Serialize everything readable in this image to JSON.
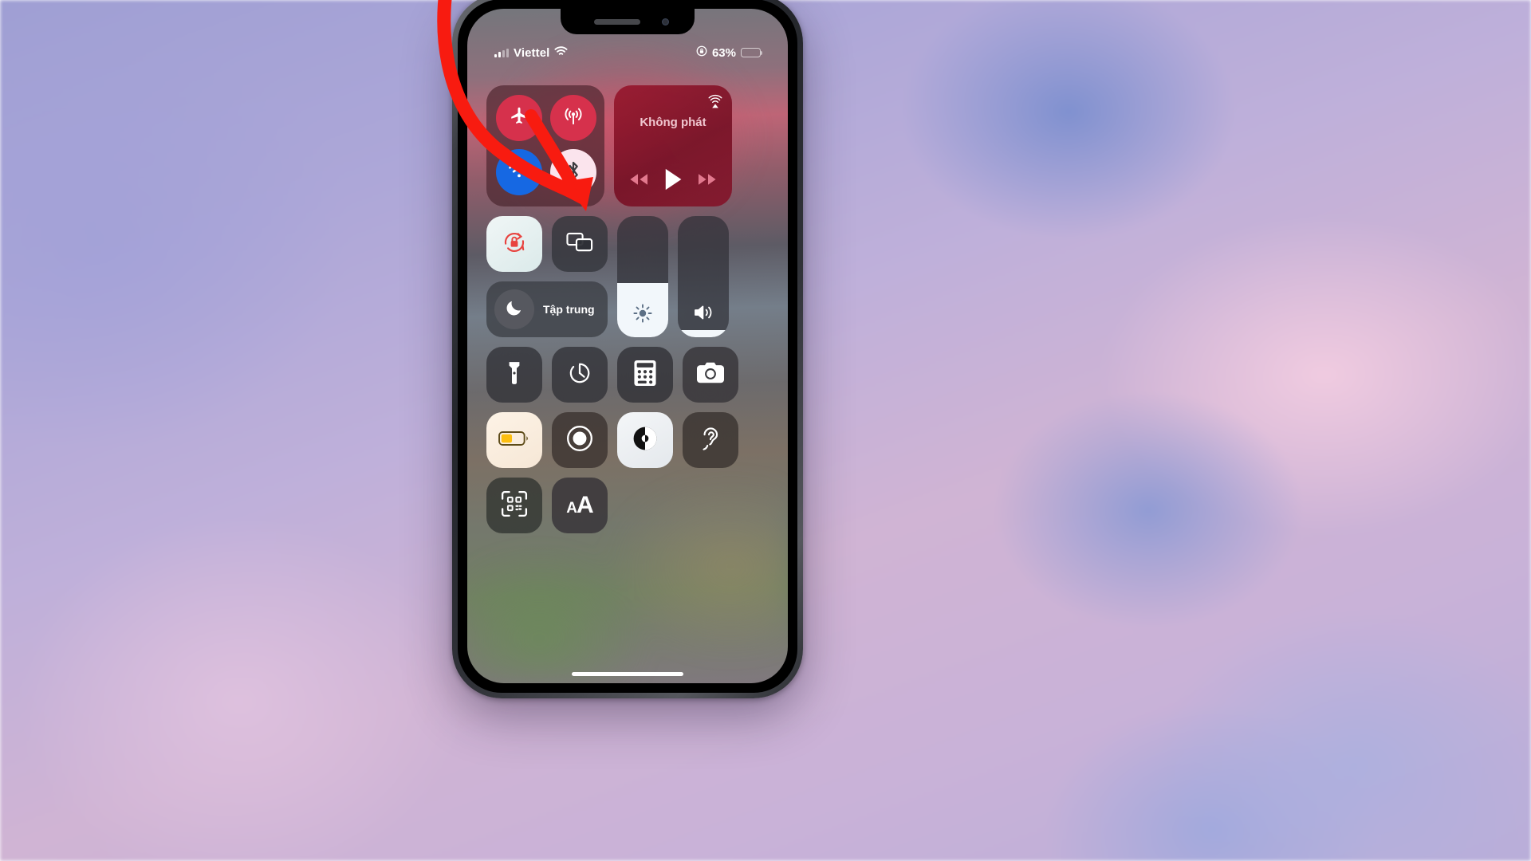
{
  "wallpaper": {
    "description": "blurred pastel sky",
    "colors": [
      "#a09fd4",
      "#c9b2d8",
      "#e2c4e0",
      "#7a8cce"
    ]
  },
  "phone": {
    "notch": {
      "speaker": "earpiece-speaker",
      "camera": "front-camera"
    },
    "home_indicator": "home-indicator"
  },
  "status_bar": {
    "carrier": "Viettel",
    "signal_icon": "cellular-signal-icon",
    "wifi_icon": "wifi-icon",
    "rotation_lock_icon": "rotation-lock-icon",
    "battery_percent": "63%",
    "battery_level": 63,
    "battery_color": "#fdc500",
    "battery_icon": "battery-icon"
  },
  "control_center": {
    "connectivity": {
      "toggles": [
        {
          "name": "airplane-mode",
          "icon": "airplane-icon",
          "state": "off",
          "color": "#d6314c"
        },
        {
          "name": "cellular-data",
          "icon": "cellular-icon",
          "state": "off",
          "color": "#d6314c"
        },
        {
          "name": "wifi",
          "icon": "wifi-icon",
          "state": "on",
          "color": "#1668e3"
        },
        {
          "name": "bluetooth",
          "icon": "bluetooth-icon",
          "state": "on",
          "color": "#fbe4ed",
          "highlighted": true
        }
      ]
    },
    "media_player": {
      "title": "Không phát",
      "airplay_icon": "airplay-icon",
      "controls": [
        {
          "name": "rewind-button",
          "icon": "rewind-icon"
        },
        {
          "name": "play-button",
          "icon": "play-icon"
        },
        {
          "name": "forward-button",
          "icon": "forward-icon"
        }
      ]
    },
    "rotation_lock": {
      "name": "rotation-lock-toggle",
      "icon": "rotation-lock-icon",
      "state": "on",
      "accent": "#e8433f"
    },
    "screen_mirroring": {
      "name": "screen-mirroring-toggle",
      "icon": "screen-mirroring-icon",
      "state": "off"
    },
    "focus": {
      "label": "Tập trung",
      "icon": "moon-icon",
      "state": "off"
    },
    "brightness": {
      "name": "brightness-slider",
      "icon": "brightness-icon",
      "value": 45
    },
    "volume": {
      "name": "volume-slider",
      "icon": "volume-icon",
      "value": 6
    },
    "shortcuts": [
      {
        "name": "flashlight",
        "icon": "flashlight-icon",
        "state": "off"
      },
      {
        "name": "timer",
        "icon": "timer-icon",
        "state": "off"
      },
      {
        "name": "calculator",
        "icon": "calculator-icon",
        "state": "off"
      },
      {
        "name": "camera",
        "icon": "camera-icon",
        "state": "off"
      },
      {
        "name": "low-power-mode",
        "icon": "low-power-icon",
        "state": "on"
      },
      {
        "name": "screen-record",
        "icon": "screen-record-icon",
        "state": "off"
      },
      {
        "name": "dark-mode",
        "icon": "dark-mode-icon",
        "state": "on"
      },
      {
        "name": "hearing",
        "icon": "hearing-icon",
        "state": "off"
      },
      {
        "name": "qr-scanner",
        "icon": "qr-code-icon",
        "state": "off"
      },
      {
        "name": "text-size",
        "icon": "text-size-icon",
        "label": "AA",
        "state": "off"
      }
    ]
  },
  "annotation": {
    "type": "curved-arrow",
    "color": "#f81b10",
    "points_to": "bluetooth-toggle"
  }
}
